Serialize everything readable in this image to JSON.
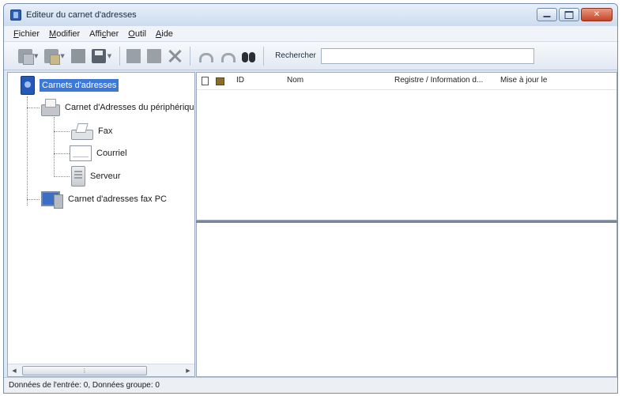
{
  "window": {
    "title": "Editeur du carnet d'adresses"
  },
  "menu": [
    {
      "label": "Fichier",
      "accel": "F",
      "rest": "ichier"
    },
    {
      "label": "Modifier",
      "accel": "M",
      "rest": "odifier"
    },
    {
      "label": "Afficher",
      "pre": "Affi",
      "accel": "c",
      "rest": "her"
    },
    {
      "label": "Outil",
      "accel": "O",
      "rest": "util"
    },
    {
      "label": "Aide",
      "accel": "A",
      "rest": "ide"
    }
  ],
  "toolbar": {
    "icons": [
      "new-address-icon",
      "new-group-icon",
      "edit-icon",
      "save-icon",
      "copy-icon",
      "paste-icon",
      "delete-icon",
      "undo-icon",
      "redo-icon",
      "find-icon"
    ],
    "search_label": "Rechercher",
    "search_value": ""
  },
  "tree": {
    "root": "Carnets d'adresses",
    "device_book": "Carnet d'Adresses du périphériqu",
    "fax": "Fax",
    "email": "Courriel",
    "server": "Serveur",
    "pc_fax_book": "Carnet d'adresses fax PC"
  },
  "list": {
    "columns": [
      "ID",
      "Nom",
      "Registre / Information d...",
      "Mise à jour le"
    ],
    "rows": []
  },
  "status": {
    "text": "Données de l'entrée: 0, Données groupe: 0"
  },
  "colors": {
    "selection": "#3b78d8",
    "window_frame": "#dde8f5",
    "close_button": "#c4452a"
  }
}
